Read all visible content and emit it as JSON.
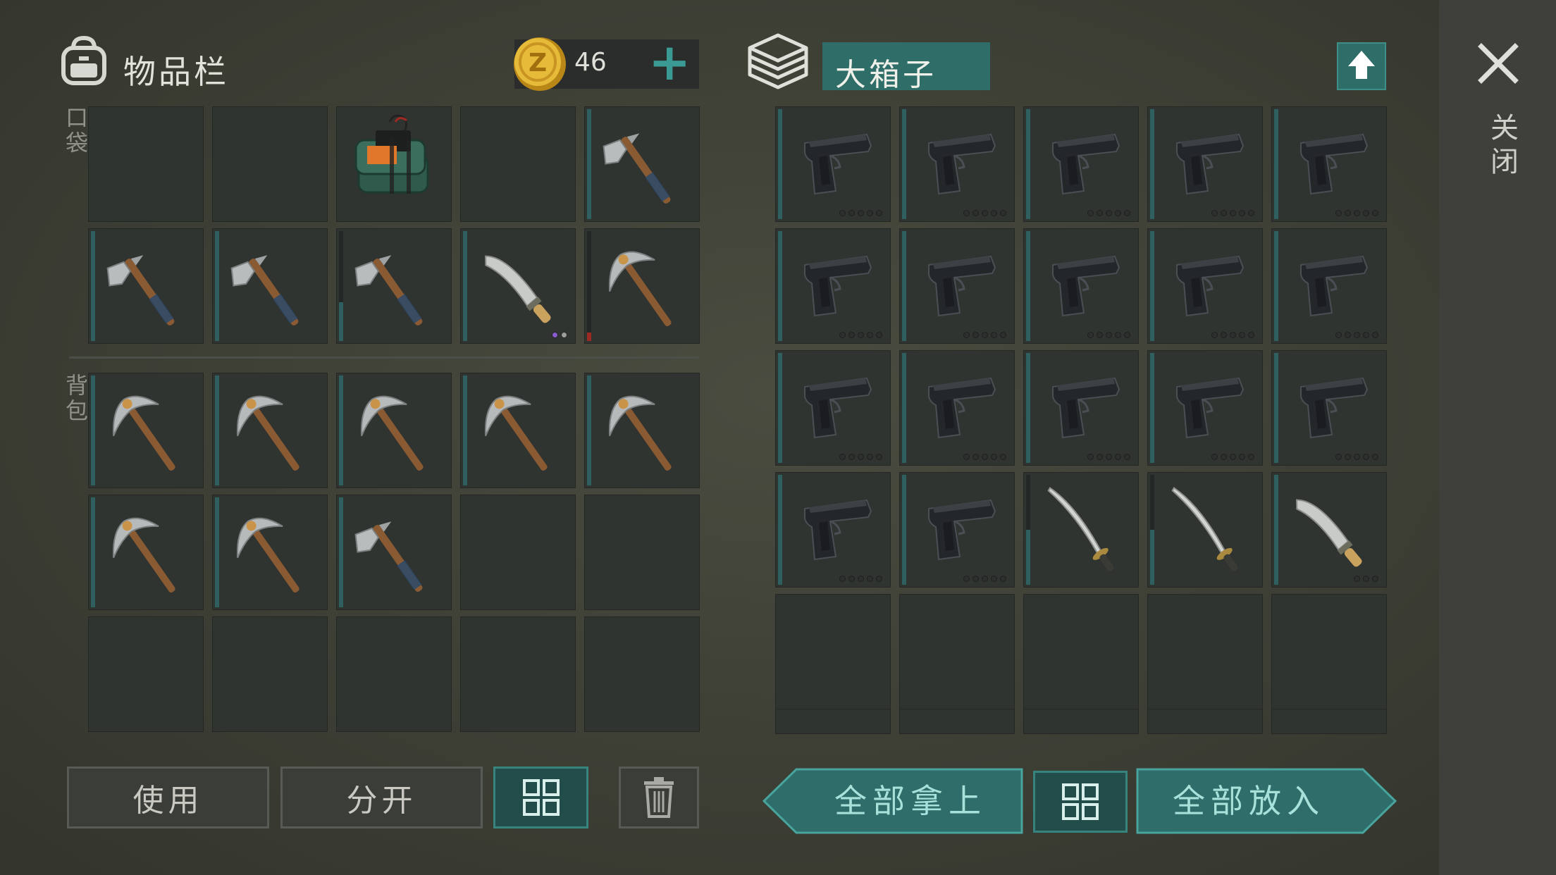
{
  "inventory": {
    "title": "物品栏",
    "coins": "46",
    "add_coins_symbol": "+",
    "pocket_label": "口袋",
    "backpack_label": "背包"
  },
  "container": {
    "title": "大箱子",
    "close_label": "关闭"
  },
  "buttons": {
    "use": "使用",
    "split": "分开",
    "take_all": "全部拿上",
    "put_all": "全部放入"
  },
  "icons": {
    "backpack": "backpack-icon",
    "coin": "coin-icon",
    "crate": "crate-icon",
    "upload": "upload-arrow-icon",
    "close": "close-icon",
    "sort": "sort-grid-icon",
    "trash": "trash-icon"
  },
  "colors": {
    "accent_teal": "#2f6d69",
    "durability_teal": "#2f5f5e",
    "durability_low": "#9a2a22",
    "rare_dot": "#8a5cd0"
  },
  "pocket_slots": [
    {
      "item": ""
    },
    {
      "item": ""
    },
    {
      "item": "c4-explosive"
    },
    {
      "item": ""
    },
    {
      "item": "axe",
      "durability": 1.0
    },
    {
      "item": "axe",
      "durability": 1.0
    },
    {
      "item": "axe",
      "durability": 1.0
    },
    {
      "item": "axe",
      "durability": 0.35
    },
    {
      "item": "machete",
      "durability": 1.0,
      "dots": [
        "p",
        "g"
      ]
    },
    {
      "item": "pickaxe",
      "durability": 0.08,
      "low": true
    }
  ],
  "backpack_slots": [
    {
      "item": "pickaxe",
      "durability": 1.0
    },
    {
      "item": "pickaxe",
      "durability": 1.0
    },
    {
      "item": "pickaxe",
      "durability": 1.0
    },
    {
      "item": "pickaxe",
      "durability": 1.0
    },
    {
      "item": "pickaxe",
      "durability": 1.0
    },
    {
      "item": "pickaxe",
      "durability": 1.0
    },
    {
      "item": "pickaxe",
      "durability": 1.0
    },
    {
      "item": "axe",
      "durability": 1.0
    },
    {
      "item": ""
    },
    {
      "item": ""
    },
    {
      "item": ""
    },
    {
      "item": ""
    },
    {
      "item": ""
    },
    {
      "item": ""
    },
    {
      "item": ""
    }
  ],
  "crate_slots": [
    {
      "item": "pistol",
      "durability": 1.0,
      "dots": [
        "",
        "",
        "",
        "",
        ""
      ]
    },
    {
      "item": "pistol",
      "durability": 1.0,
      "dots": [
        "",
        "",
        "",
        "",
        ""
      ]
    },
    {
      "item": "pistol",
      "durability": 1.0,
      "dots": [
        "",
        "",
        "",
        "",
        ""
      ]
    },
    {
      "item": "pistol",
      "durability": 1.0,
      "dots": [
        "",
        "",
        "",
        "",
        ""
      ]
    },
    {
      "item": "pistol",
      "durability": 1.0,
      "dots": [
        "",
        "",
        "",
        "",
        ""
      ]
    },
    {
      "item": "pistol",
      "durability": 1.0,
      "dots": [
        "",
        "",
        "",
        "",
        ""
      ]
    },
    {
      "item": "pistol",
      "durability": 1.0,
      "dots": [
        "",
        "",
        "",
        "",
        ""
      ]
    },
    {
      "item": "pistol",
      "durability": 1.0,
      "dots": [
        "",
        "",
        "",
        "",
        ""
      ]
    },
    {
      "item": "pistol",
      "durability": 1.0,
      "dots": [
        "",
        "",
        "",
        "",
        ""
      ]
    },
    {
      "item": "pistol",
      "durability": 1.0,
      "dots": [
        "",
        "",
        "",
        "",
        ""
      ]
    },
    {
      "item": "pistol",
      "durability": 1.0,
      "dots": [
        "",
        "",
        "",
        "",
        ""
      ]
    },
    {
      "item": "pistol",
      "durability": 1.0,
      "dots": [
        "",
        "",
        "",
        "",
        ""
      ]
    },
    {
      "item": "pistol",
      "durability": 1.0,
      "dots": [
        "",
        "",
        "",
        "",
        ""
      ]
    },
    {
      "item": "pistol",
      "durability": 1.0,
      "dots": [
        "",
        "",
        "",
        "",
        ""
      ]
    },
    {
      "item": "pistol",
      "durability": 1.0,
      "dots": [
        "",
        "",
        "",
        "",
        ""
      ]
    },
    {
      "item": "pistol",
      "durability": 1.0,
      "dots": [
        "",
        "",
        "",
        "",
        ""
      ]
    },
    {
      "item": "pistol",
      "durability": 1.0,
      "dots": [
        "",
        "",
        "",
        "",
        ""
      ]
    },
    {
      "item": "katana",
      "durability": 0.5
    },
    {
      "item": "katana",
      "durability": 0.5
    },
    {
      "item": "machete",
      "durability": 1.0,
      "dots": [
        "",
        "",
        ""
      ]
    },
    {
      "item": ""
    },
    {
      "item": ""
    },
    {
      "item": ""
    },
    {
      "item": ""
    },
    {
      "item": ""
    }
  ]
}
